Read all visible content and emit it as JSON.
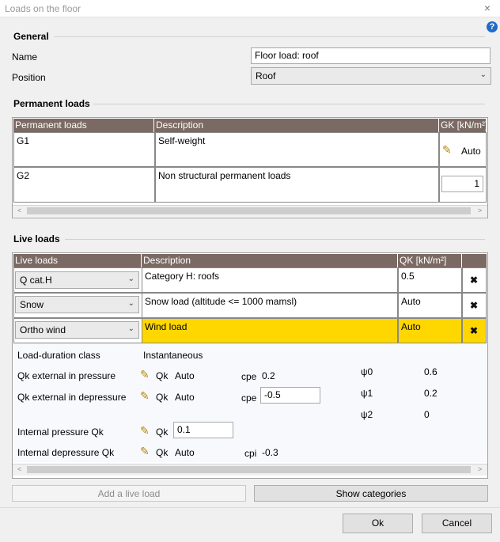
{
  "window": {
    "title": "Loads on the floor",
    "close_glyph": "×",
    "help_glyph": "?"
  },
  "general": {
    "section_title": "General",
    "name_label": "Name",
    "name_value": "Floor load: roof",
    "position_label": "Position",
    "position_value": "Roof"
  },
  "permanent": {
    "section_title": "Permanent loads",
    "headers": [
      "Permanent loads",
      "Description",
      "GK [kN/m²]"
    ],
    "rows": [
      {
        "id": "G1",
        "description": "Self-weight",
        "value": "Auto"
      },
      {
        "id": "G2",
        "description": "Non structural permanent loads",
        "value": "1"
      }
    ]
  },
  "live": {
    "section_title": "Live loads",
    "headers": [
      "Live loads",
      "Description",
      "QK [kN/m²]"
    ],
    "rows": [
      {
        "type": "Q cat.H",
        "description": "Category H: roofs",
        "value": "0.5"
      },
      {
        "type": "Snow",
        "description": "Snow load (altitude <= 1000 mamsl)",
        "value": "Auto"
      },
      {
        "type": "Ortho wind",
        "description": "Wind load",
        "value": "Auto"
      }
    ],
    "highlight_color": "#ffd700",
    "details": {
      "duration_label": "Load-duration class",
      "duration_value": "Instantaneous",
      "qk_ext_pressure_label": "Qk external in pressure",
      "qk_ext_depressure_label": "Qk external in depressure",
      "internal_pressure_label": "Internal pressure Qk",
      "internal_depressure_label": "Internal depressure Qk",
      "qk_text": "Qk",
      "auto_text": "Auto",
      "cpe_label": "cpe",
      "cpi_label": "cpi",
      "cpe_pressure_value": "0.2",
      "cpe_depressure_value": "-0.5",
      "internal_pressure_value": "0.1",
      "cpi_value": "-0.3",
      "psi0_label": "ψ0",
      "psi1_label": "ψ1",
      "psi2_label": "ψ2",
      "psi0_value": "0.6",
      "psi1_value": "0.2",
      "psi2_value": "0"
    }
  },
  "buttons": {
    "add_live_load": "Add a live load",
    "show_categories": "Show categories",
    "ok": "Ok",
    "cancel": "Cancel"
  },
  "icons": {
    "pencil": "pencil-icon",
    "delete": "delete-x-icon",
    "help": "help-icon",
    "close": "close-icon",
    "chevron": "chevron-down-icon"
  }
}
